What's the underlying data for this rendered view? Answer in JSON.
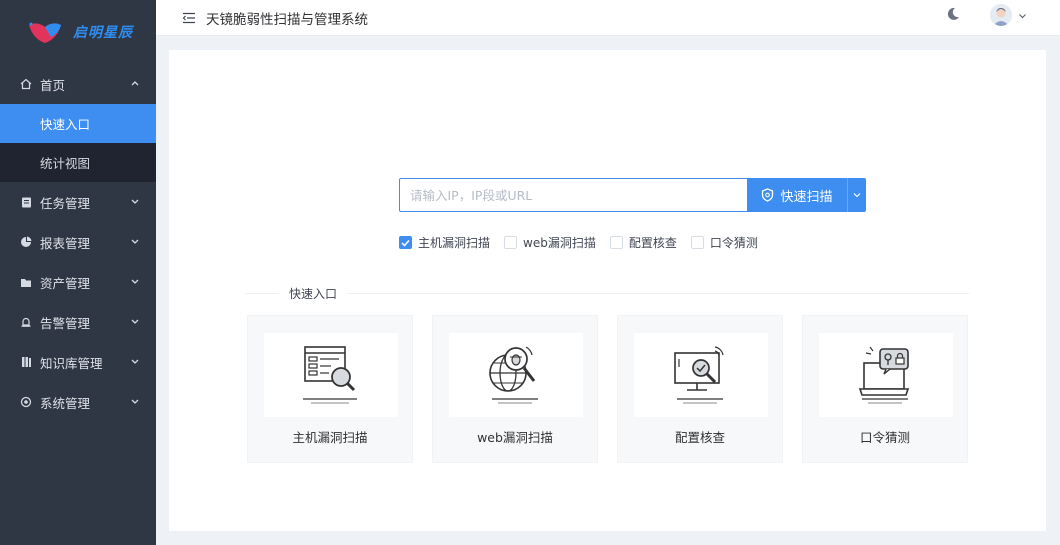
{
  "brand": {
    "logo_text": "启明星辰"
  },
  "header": {
    "title": "天镜脆弱性扫描与管理系统"
  },
  "sidebar": {
    "home": {
      "label": "首页",
      "sub": [
        {
          "label": "快速入口",
          "active": true
        },
        {
          "label": "统计视图",
          "active": false
        }
      ]
    },
    "items": [
      {
        "label": "任务管理",
        "icon": "clipboard-icon"
      },
      {
        "label": "报表管理",
        "icon": "pie-chart-icon"
      },
      {
        "label": "资产管理",
        "icon": "folder-icon"
      },
      {
        "label": "告警管理",
        "icon": "alarm-icon"
      },
      {
        "label": "知识库管理",
        "icon": "book-icon"
      },
      {
        "label": "系统管理",
        "icon": "settings-icon"
      }
    ]
  },
  "search": {
    "placeholder": "请输入IP，IP段或URL",
    "value": "",
    "button_label": "快速扫描"
  },
  "options": [
    {
      "label": "主机漏洞扫描",
      "checked": true
    },
    {
      "label": "web漏洞扫描",
      "checked": false
    },
    {
      "label": "配置核查",
      "checked": false
    },
    {
      "label": "口令猜测",
      "checked": false
    }
  ],
  "quick_entry": {
    "title": "快速入口",
    "tiles": [
      {
        "label": "主机漏洞扫描",
        "icon": "host-scan-icon"
      },
      {
        "label": "web漏洞扫描",
        "icon": "web-scan-icon"
      },
      {
        "label": "配置核查",
        "icon": "config-check-icon"
      },
      {
        "label": "口令猜测",
        "icon": "password-guess-icon"
      }
    ]
  },
  "colors": {
    "accent": "#3d8ef0",
    "sidebar_bg": "#2f3644",
    "submenu_bg": "#1f2430"
  }
}
